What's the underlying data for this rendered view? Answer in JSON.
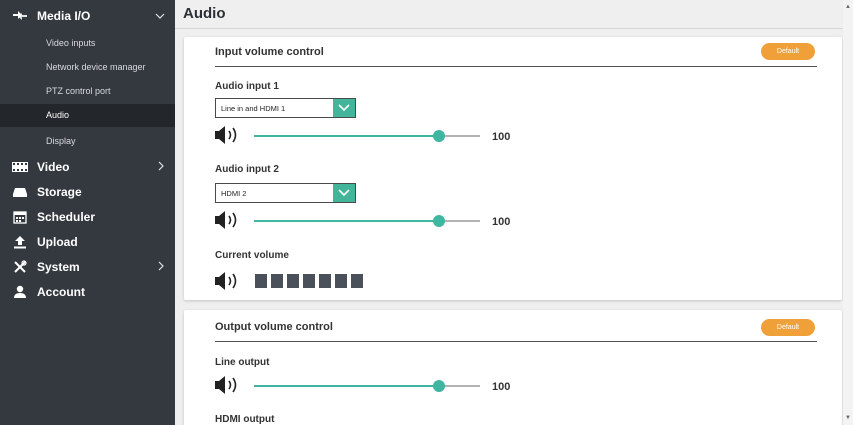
{
  "sidebar": {
    "media_io": {
      "label": "Media I/O",
      "icon": "arrows-icon",
      "expanded": true
    },
    "sub_items": [
      {
        "label": "Video inputs",
        "active": false
      },
      {
        "label": "Network device manager",
        "active": false
      },
      {
        "label": "PTZ control port",
        "active": false
      },
      {
        "label": "Audio",
        "active": true
      },
      {
        "label": "Display",
        "active": false
      }
    ],
    "video": {
      "label": "Video",
      "icon": "film-icon"
    },
    "storage": {
      "label": "Storage",
      "icon": "drive-icon"
    },
    "scheduler": {
      "label": "Scheduler",
      "icon": "calendar-icon"
    },
    "upload": {
      "label": "Upload",
      "icon": "upload-icon"
    },
    "system": {
      "label": "System",
      "icon": "tools-icon"
    },
    "account": {
      "label": "Account",
      "icon": "user-icon"
    }
  },
  "page": {
    "title": "Audio"
  },
  "input_card": {
    "title": "Input volume control",
    "default_label": "Default",
    "audio_input_1": {
      "label": "Audio input 1",
      "select_value": "Line in and HDMI 1",
      "volume": 100,
      "level": 0.82
    },
    "audio_input_2": {
      "label": "Audio input 2",
      "select_value": "HDMI 2",
      "volume": 100,
      "level": 0.82
    },
    "current_volume": {
      "label": "Current volume",
      "segments": 7
    }
  },
  "output_card": {
    "title": "Output volume control",
    "default_label": "Default",
    "line_output": {
      "label": "Line output",
      "volume": 100,
      "level": 0.82
    },
    "hdmi_output": {
      "label": "HDMI output"
    }
  },
  "colors": {
    "sidebar": "#34393f",
    "active_item": "#23272b",
    "accent": "#3fb6a0",
    "default_button": "#f0a038"
  }
}
